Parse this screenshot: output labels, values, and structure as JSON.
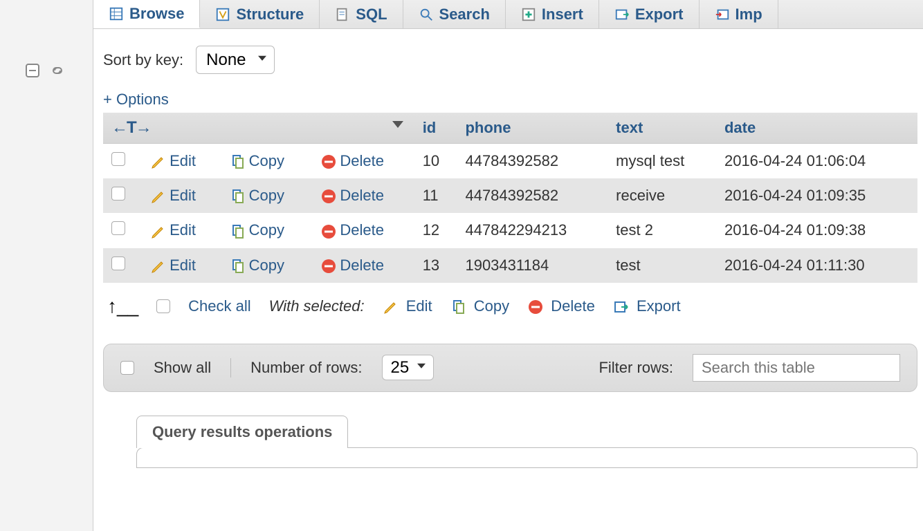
{
  "tabs": {
    "browse": "Browse",
    "structure": "Structure",
    "sql": "SQL",
    "search": "Search",
    "insert": "Insert",
    "export": "Export",
    "import": "Imp"
  },
  "sort": {
    "label": "Sort by key:",
    "value": "None"
  },
  "options_link": "+ Options",
  "table": {
    "headers": {
      "id": "id",
      "phone": "phone",
      "text": "text",
      "date": "date"
    },
    "actions": {
      "edit": "Edit",
      "copy": "Copy",
      "delete": "Delete"
    },
    "rows": [
      {
        "id": "10",
        "phone": "44784392582",
        "text": "mysql test",
        "date": "2016-04-24 01:06:04"
      },
      {
        "id": "11",
        "phone": "44784392582",
        "text": "receive",
        "date": "2016-04-24 01:09:35"
      },
      {
        "id": "12",
        "phone": "447842294213",
        "text": "test 2",
        "date": "2016-04-24 01:09:38"
      },
      {
        "id": "13",
        "phone": "1903431184",
        "text": "test",
        "date": "2016-04-24 01:11:30"
      }
    ]
  },
  "bulk": {
    "check_all": "Check all",
    "with_selected": "With selected:",
    "edit": "Edit",
    "copy": "Copy",
    "delete": "Delete",
    "export": "Export"
  },
  "pager": {
    "show_all": "Show all",
    "num_rows_label": "Number of rows:",
    "num_rows_value": "25",
    "filter_label": "Filter rows:",
    "filter_placeholder": "Search this table"
  },
  "qro_title": "Query results operations"
}
